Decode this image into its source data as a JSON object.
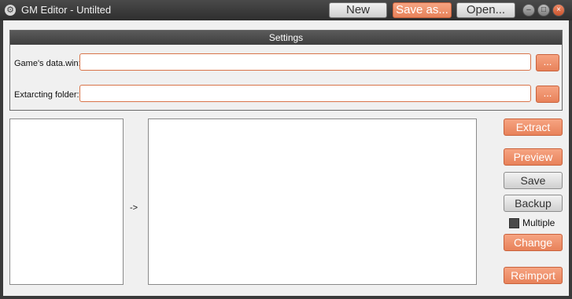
{
  "window": {
    "title": "GM Editor - Untilted",
    "icon": "gear-icon"
  },
  "titlebar_buttons": {
    "new_label": "New",
    "save_as_label": "Save as...",
    "open_label": "Open..."
  },
  "window_controls": {
    "minimize": "–",
    "maximize": "□",
    "close": "×"
  },
  "settings": {
    "header": "Settings",
    "data_win_label": "Game's data.win:",
    "data_win_value": "",
    "folder_label": "Extarcting folder:",
    "folder_value": "",
    "browse_label": "..."
  },
  "main": {
    "arrow": "->"
  },
  "actions": {
    "extract": "Extract",
    "preview": "Preview",
    "save": "Save",
    "backup": "Backup",
    "multiple_label": "Multiple",
    "change": "Change",
    "reimport": "Reimport"
  },
  "colors": {
    "accent": "#e8825a",
    "titlebar": "#3a3a3a",
    "background": "#f0f0f0"
  }
}
